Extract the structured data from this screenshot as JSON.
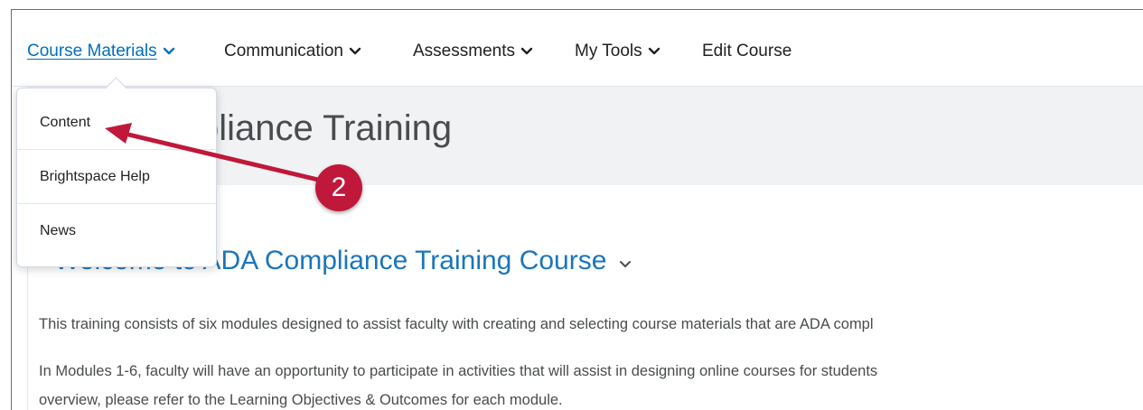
{
  "navbar": {
    "items": [
      {
        "label": "Course Materials",
        "has_menu": true,
        "active": true
      },
      {
        "label": "Communication",
        "has_menu": true
      },
      {
        "label": "Assessments",
        "has_menu": true
      },
      {
        "label": "My Tools",
        "has_menu": true
      },
      {
        "label": "Edit Course",
        "has_menu": false
      }
    ]
  },
  "course": {
    "title_visible": "pliance Training"
  },
  "dropdown": {
    "items": [
      "Content",
      "Brightspace Help",
      "News"
    ]
  },
  "content": {
    "welcome_title": "Welcome to ADA Compliance Training Course",
    "paragraph_1": "This training consists of six modules designed to assist faculty with creating and selecting course materials that are ADA compl",
    "paragraph_2": "In Modules 1-6, faculty will have an opportunity to participate in activities that will assist in designing online courses for students",
    "paragraph_3": "overview, please refer to the Learning Objectives & Outcomes for each module."
  },
  "annotation": {
    "step_number": "2",
    "color": "#c0183a"
  },
  "colors": {
    "link_blue": "#006fbf",
    "heading_blue": "#1b75bc",
    "band_gray": "#f1f2f4"
  },
  "icons": {
    "nav_chevron": "chevron-down-icon",
    "welcome_chevron": "chevron-down-icon",
    "arrow": "arrow-annotation"
  }
}
